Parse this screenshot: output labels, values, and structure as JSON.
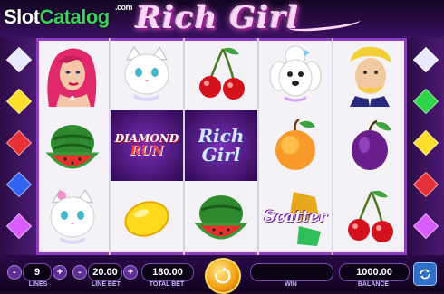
{
  "watermark": {
    "slot": "Slot",
    "catalog": "Catalog",
    "com": ".com"
  },
  "game_title": "Rich Girl",
  "reels": [
    [
      "woman-symbol",
      "watermelon-symbol",
      "white-cat-symbol"
    ],
    [
      "white-cat-symbol",
      "diamond-run-symbol",
      "lemon-symbol"
    ],
    [
      "cherry-symbol",
      "rich-girl-wild-symbol",
      "watermelon-symbol"
    ],
    [
      "poodle-symbol",
      "peach-symbol",
      "scatter-symbol"
    ],
    [
      "butler-symbol",
      "plum-symbol",
      "cherry-symbol"
    ]
  ],
  "symbols": {
    "diamond_run": [
      "DIAMOND",
      "RUN"
    ],
    "rich_girl": [
      "Rich",
      "Girl"
    ],
    "scatter": "Scatter"
  },
  "controls": {
    "lines_value": "9",
    "lines_label": "LINES",
    "line_bet_value": "20.00",
    "line_bet_label": "LINE BET",
    "total_bet_value": "180.00",
    "total_bet_label": "TOTAL BET",
    "win_value": "",
    "win_label": "WIN",
    "balance_value": "1000.00",
    "balance_label": "BALANCE",
    "minus": "-",
    "plus": "+"
  },
  "colors": {
    "frame_purple": "#5a1f80",
    "logo_pink": "#ffd6f6",
    "watermark_green": "#3fd160",
    "spin_gold": "#f29d0b",
    "home_blue": "#2f6fc9"
  },
  "side_gems": [
    "#e8e8ff",
    "#ffde2e",
    "#e83038",
    "#3064f0",
    "#d85cff",
    "#e8e8ff",
    "#2fd64a",
    "#ffde2e",
    "#e83038",
    "#d85cff"
  ]
}
